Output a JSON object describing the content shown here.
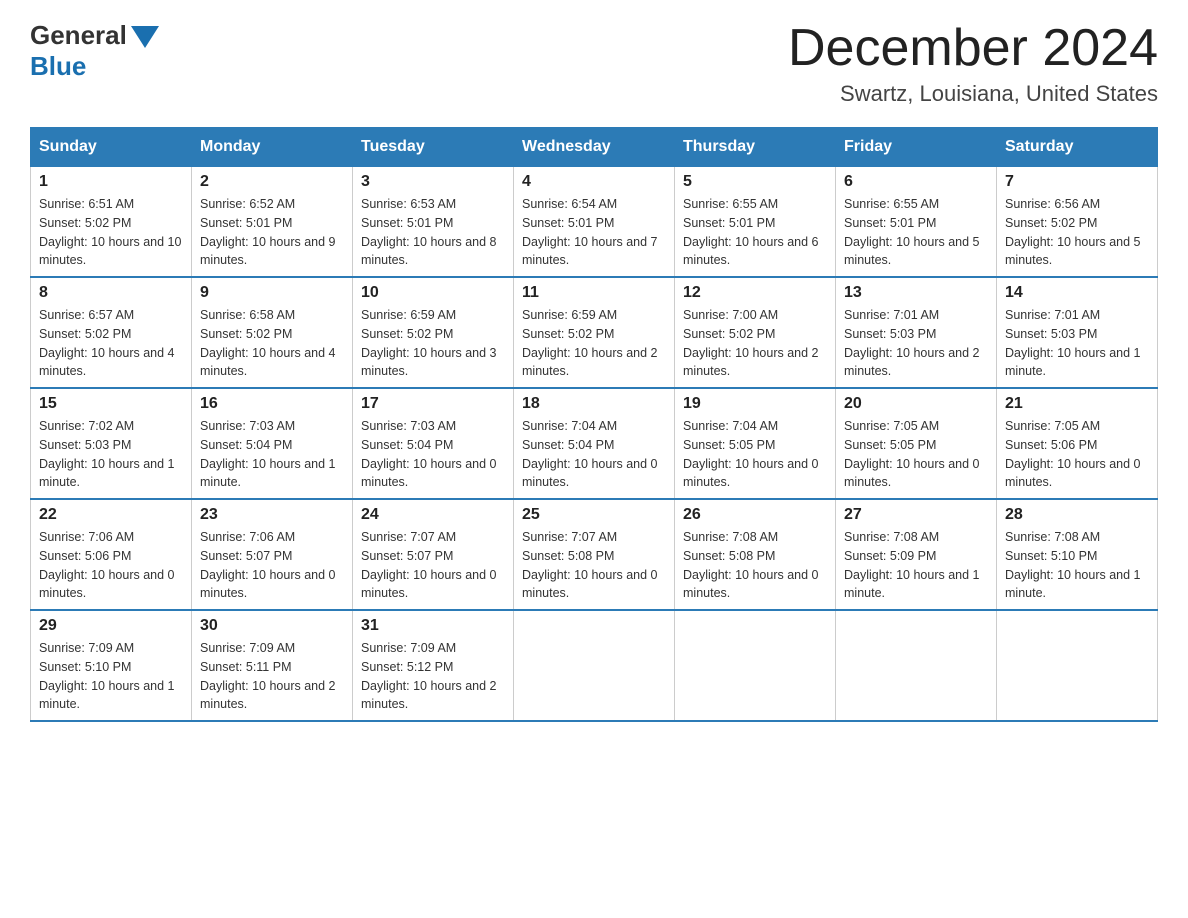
{
  "header": {
    "logo_general": "General",
    "logo_blue": "Blue",
    "month_title": "December 2024",
    "location": "Swartz, Louisiana, United States"
  },
  "days_of_week": [
    "Sunday",
    "Monday",
    "Tuesday",
    "Wednesday",
    "Thursday",
    "Friday",
    "Saturday"
  ],
  "weeks": [
    [
      {
        "day": "1",
        "sunrise": "6:51 AM",
        "sunset": "5:02 PM",
        "daylight": "10 hours and 10 minutes."
      },
      {
        "day": "2",
        "sunrise": "6:52 AM",
        "sunset": "5:01 PM",
        "daylight": "10 hours and 9 minutes."
      },
      {
        "day": "3",
        "sunrise": "6:53 AM",
        "sunset": "5:01 PM",
        "daylight": "10 hours and 8 minutes."
      },
      {
        "day": "4",
        "sunrise": "6:54 AM",
        "sunset": "5:01 PM",
        "daylight": "10 hours and 7 minutes."
      },
      {
        "day": "5",
        "sunrise": "6:55 AM",
        "sunset": "5:01 PM",
        "daylight": "10 hours and 6 minutes."
      },
      {
        "day": "6",
        "sunrise": "6:55 AM",
        "sunset": "5:01 PM",
        "daylight": "10 hours and 5 minutes."
      },
      {
        "day": "7",
        "sunrise": "6:56 AM",
        "sunset": "5:02 PM",
        "daylight": "10 hours and 5 minutes."
      }
    ],
    [
      {
        "day": "8",
        "sunrise": "6:57 AM",
        "sunset": "5:02 PM",
        "daylight": "10 hours and 4 minutes."
      },
      {
        "day": "9",
        "sunrise": "6:58 AM",
        "sunset": "5:02 PM",
        "daylight": "10 hours and 4 minutes."
      },
      {
        "day": "10",
        "sunrise": "6:59 AM",
        "sunset": "5:02 PM",
        "daylight": "10 hours and 3 minutes."
      },
      {
        "day": "11",
        "sunrise": "6:59 AM",
        "sunset": "5:02 PM",
        "daylight": "10 hours and 2 minutes."
      },
      {
        "day": "12",
        "sunrise": "7:00 AM",
        "sunset": "5:02 PM",
        "daylight": "10 hours and 2 minutes."
      },
      {
        "day": "13",
        "sunrise": "7:01 AM",
        "sunset": "5:03 PM",
        "daylight": "10 hours and 2 minutes."
      },
      {
        "day": "14",
        "sunrise": "7:01 AM",
        "sunset": "5:03 PM",
        "daylight": "10 hours and 1 minute."
      }
    ],
    [
      {
        "day": "15",
        "sunrise": "7:02 AM",
        "sunset": "5:03 PM",
        "daylight": "10 hours and 1 minute."
      },
      {
        "day": "16",
        "sunrise": "7:03 AM",
        "sunset": "5:04 PM",
        "daylight": "10 hours and 1 minute."
      },
      {
        "day": "17",
        "sunrise": "7:03 AM",
        "sunset": "5:04 PM",
        "daylight": "10 hours and 0 minutes."
      },
      {
        "day": "18",
        "sunrise": "7:04 AM",
        "sunset": "5:04 PM",
        "daylight": "10 hours and 0 minutes."
      },
      {
        "day": "19",
        "sunrise": "7:04 AM",
        "sunset": "5:05 PM",
        "daylight": "10 hours and 0 minutes."
      },
      {
        "day": "20",
        "sunrise": "7:05 AM",
        "sunset": "5:05 PM",
        "daylight": "10 hours and 0 minutes."
      },
      {
        "day": "21",
        "sunrise": "7:05 AM",
        "sunset": "5:06 PM",
        "daylight": "10 hours and 0 minutes."
      }
    ],
    [
      {
        "day": "22",
        "sunrise": "7:06 AM",
        "sunset": "5:06 PM",
        "daylight": "10 hours and 0 minutes."
      },
      {
        "day": "23",
        "sunrise": "7:06 AM",
        "sunset": "5:07 PM",
        "daylight": "10 hours and 0 minutes."
      },
      {
        "day": "24",
        "sunrise": "7:07 AM",
        "sunset": "5:07 PM",
        "daylight": "10 hours and 0 minutes."
      },
      {
        "day": "25",
        "sunrise": "7:07 AM",
        "sunset": "5:08 PM",
        "daylight": "10 hours and 0 minutes."
      },
      {
        "day": "26",
        "sunrise": "7:08 AM",
        "sunset": "5:08 PM",
        "daylight": "10 hours and 0 minutes."
      },
      {
        "day": "27",
        "sunrise": "7:08 AM",
        "sunset": "5:09 PM",
        "daylight": "10 hours and 1 minute."
      },
      {
        "day": "28",
        "sunrise": "7:08 AM",
        "sunset": "5:10 PM",
        "daylight": "10 hours and 1 minute."
      }
    ],
    [
      {
        "day": "29",
        "sunrise": "7:09 AM",
        "sunset": "5:10 PM",
        "daylight": "10 hours and 1 minute."
      },
      {
        "day": "30",
        "sunrise": "7:09 AM",
        "sunset": "5:11 PM",
        "daylight": "10 hours and 2 minutes."
      },
      {
        "day": "31",
        "sunrise": "7:09 AM",
        "sunset": "5:12 PM",
        "daylight": "10 hours and 2 minutes."
      },
      {
        "day": "",
        "sunrise": "",
        "sunset": "",
        "daylight": ""
      },
      {
        "day": "",
        "sunrise": "",
        "sunset": "",
        "daylight": ""
      },
      {
        "day": "",
        "sunrise": "",
        "sunset": "",
        "daylight": ""
      },
      {
        "day": "",
        "sunrise": "",
        "sunset": "",
        "daylight": ""
      }
    ]
  ],
  "labels": {
    "sunrise_prefix": "Sunrise: ",
    "sunset_prefix": "Sunset: ",
    "daylight_prefix": "Daylight: "
  }
}
